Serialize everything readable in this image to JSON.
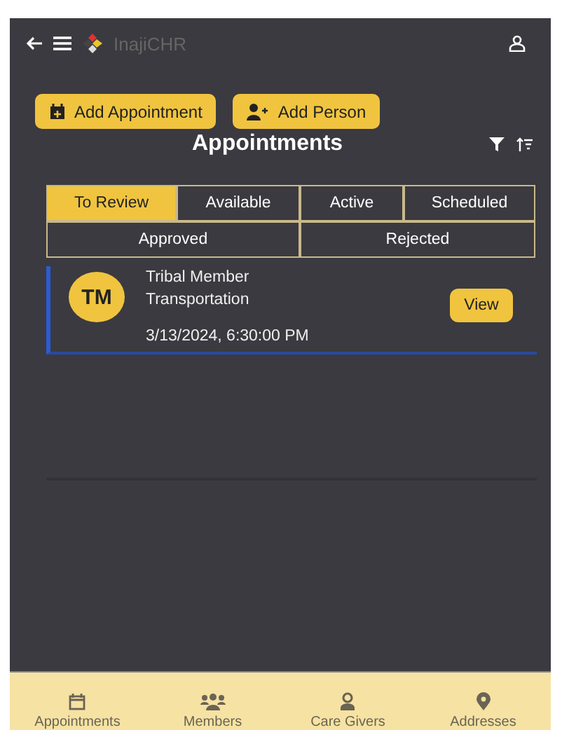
{
  "header": {
    "app_name": "InajiCHR"
  },
  "actions": [
    {
      "label": "Add Appointment",
      "kind": "calendar"
    },
    {
      "label": "Add Person",
      "kind": "person"
    }
  ],
  "title": "Appointments",
  "tabs": [
    {
      "label": "To Review",
      "selected": true
    },
    {
      "label": "Available",
      "selected": false
    },
    {
      "label": "Active",
      "selected": false
    },
    {
      "label": "Scheduled",
      "selected": false
    },
    {
      "label": "Approved",
      "selected": false
    },
    {
      "label": "Rejected",
      "selected": false
    }
  ],
  "appointments": [
    {
      "initials": "TM",
      "name": "Tribal Member",
      "type": "Transportation",
      "time": "3/13/2024, 6:30:00 PM",
      "action": "View"
    }
  ],
  "nav": [
    {
      "label": "Appointments",
      "kind": "calendar"
    },
    {
      "label": "Members",
      "kind": "group"
    },
    {
      "label": "Care Givers",
      "kind": "caregiver"
    },
    {
      "label": "Addresses",
      "kind": "pin"
    }
  ]
}
